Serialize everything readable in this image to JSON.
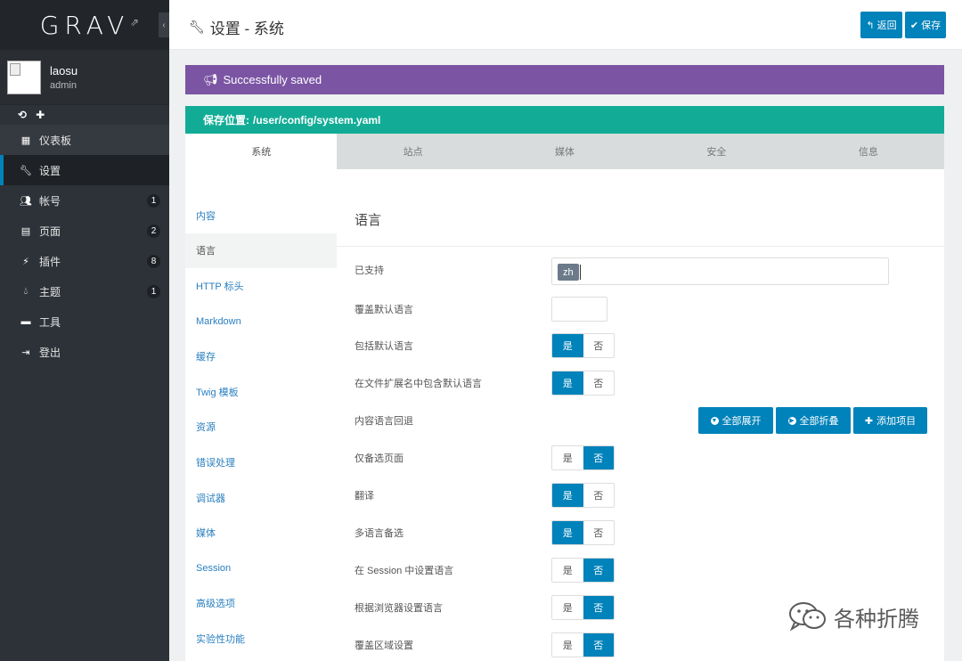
{
  "sidebar": {
    "logo": "GRAV",
    "collapse_glyph": "‹",
    "user": {
      "name": "laosu",
      "role": "admin"
    },
    "quick_icons": [
      "refresh-icon",
      "plus-icon"
    ],
    "items": [
      {
        "label": "仪表板",
        "icon": "dashboard-icon",
        "badge": ""
      },
      {
        "label": "设置",
        "icon": "wrench-icon",
        "badge": ""
      },
      {
        "label": "帐号",
        "icon": "users-icon",
        "badge": "1"
      },
      {
        "label": "页面",
        "icon": "file-icon",
        "badge": "2"
      },
      {
        "label": "插件",
        "icon": "plug-icon",
        "badge": "8"
      },
      {
        "label": "主题",
        "icon": "tint-icon",
        "badge": "1"
      },
      {
        "label": "工具",
        "icon": "briefcase-icon",
        "badge": ""
      },
      {
        "label": "登出",
        "icon": "sign-out-icon",
        "badge": ""
      }
    ]
  },
  "header": {
    "title": "设置 - 系统",
    "back_label": "返回",
    "save_label": "保存"
  },
  "alerts": {
    "success": "Successfully saved",
    "location_label": "保存位置:",
    "location_path": "/user/config/system.yaml"
  },
  "tabs": [
    "系统",
    "站点",
    "媒体",
    "安全",
    "信息"
  ],
  "subnav": [
    "内容",
    "语言",
    "HTTP 标头",
    "Markdown",
    "缓存",
    "Twig 模板",
    "资源",
    "错误处理",
    "调试器",
    "媒体",
    "Session",
    "高级选项",
    "实验性功能"
  ],
  "panel": {
    "title": "语言",
    "supported_label": "已支持",
    "supported_tag": "zh",
    "override_label": "覆盖默认语言",
    "buttons": {
      "expand": "全部展开",
      "collapse": "全部折叠",
      "add": "添加项目"
    },
    "toggles": [
      {
        "label": "包括默认语言",
        "yes": "是",
        "no": "否",
        "value": "yes"
      },
      {
        "label": "在文件扩展名中包含默认语言",
        "yes": "是",
        "no": "否",
        "value": "yes"
      },
      {
        "label": "内容语言回退"
      },
      {
        "label": "仅备选页面",
        "yes": "是",
        "no": "否",
        "value": "no"
      },
      {
        "label": "翻译",
        "yes": "是",
        "no": "否",
        "value": "yes"
      },
      {
        "label": "多语言备选",
        "yes": "是",
        "no": "否",
        "value": "yes"
      },
      {
        "label": "在 Session 中设置语言",
        "yes": "是",
        "no": "否",
        "value": "no"
      },
      {
        "label": "根据浏览器设置语言",
        "yes": "是",
        "no": "否",
        "value": "no"
      },
      {
        "label": "覆盖区域设置",
        "yes": "是",
        "no": "否",
        "value": "no"
      }
    ]
  },
  "watermark": "各种折腾",
  "colors": {
    "accent": "#0082ba",
    "success": "#7b55a3",
    "info": "#12ac96",
    "sidebar": "#2d3238"
  }
}
